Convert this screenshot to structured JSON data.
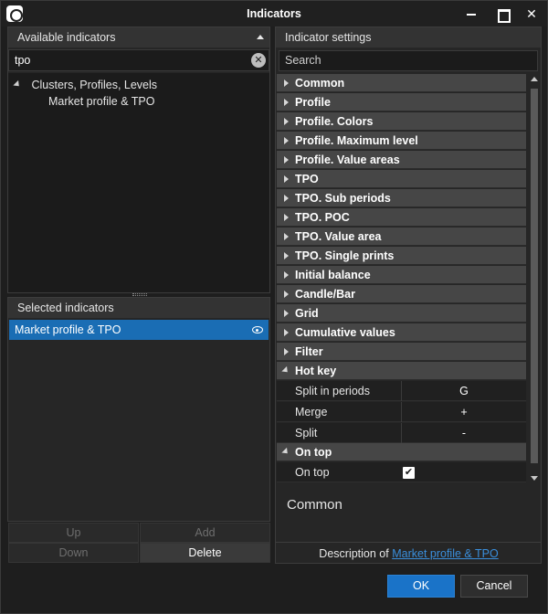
{
  "window": {
    "title": "Indicators",
    "close_glyph": "✕"
  },
  "available": {
    "header": "Available indicators",
    "search_value": "tpo",
    "clear_glyph": "✕",
    "tree": {
      "group": "Clusters, Profiles, Levels",
      "child": "Market profile & TPO"
    }
  },
  "selected": {
    "header": "Selected indicators",
    "items": [
      "Market profile & TPO"
    ],
    "buttons": {
      "up": "Up",
      "add": "Add",
      "down": "Down",
      "delete": "Delete"
    }
  },
  "settings": {
    "header": "Indicator settings",
    "search_placeholder": "Search",
    "categories": [
      "Common",
      "Profile",
      "Profile. Colors",
      "Profile. Maximum level",
      "Profile. Value areas",
      "TPO",
      "TPO. Sub periods",
      "TPO. POC",
      "TPO. Value area",
      "TPO. Single prints",
      "Initial balance",
      "Candle/Bar",
      "Grid",
      "Cumulative values",
      "Filter"
    ],
    "hot_key": {
      "title": "Hot key",
      "rows": [
        {
          "name": "Split in periods",
          "value": "G"
        },
        {
          "name": "Merge",
          "value": "+"
        },
        {
          "name": "Split",
          "value": "-"
        }
      ]
    },
    "on_top": {
      "title": "On top",
      "row_name": "On top",
      "checked": true,
      "check_glyph": "✔"
    }
  },
  "description": {
    "title": "Common",
    "prefix": "Description of",
    "link": "Market profile & TPO"
  },
  "footer": {
    "ok": "OK",
    "cancel": "Cancel"
  },
  "colors": {
    "accent": "#1a73c8",
    "selection": "#1a6db4",
    "link": "#3a8fdc"
  }
}
